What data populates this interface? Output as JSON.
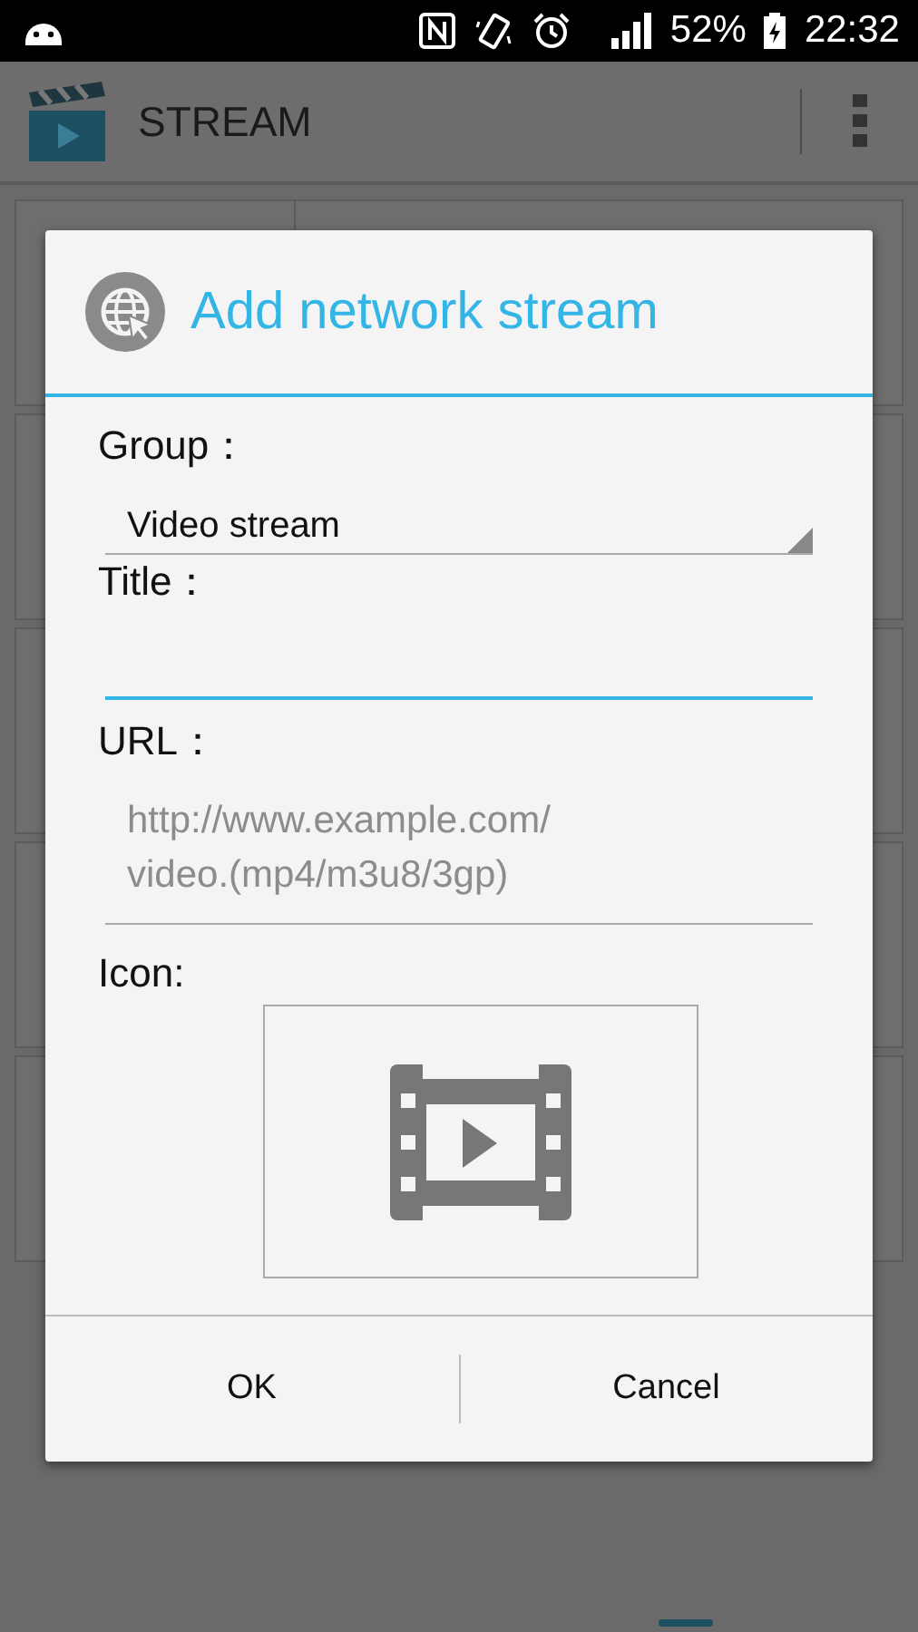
{
  "status_bar": {
    "battery": "52%",
    "time": "22:32"
  },
  "app_bar": {
    "title": "STREAM"
  },
  "dialog": {
    "title": "Add network stream",
    "fields": [
      {
        "kind": "spinner",
        "label": "Group：",
        "value": "Video stream"
      },
      {
        "kind": "text",
        "label": "Title：",
        "focused": true
      },
      {
        "kind": "text",
        "label": "URL：",
        "placeholder": "http://www.example.com/\nvideo.(mp4/m3u8/3gp)",
        "focused": false
      },
      {
        "kind": "icon",
        "label": "Icon:"
      }
    ],
    "buttons": [
      "OK",
      "Cancel"
    ]
  }
}
